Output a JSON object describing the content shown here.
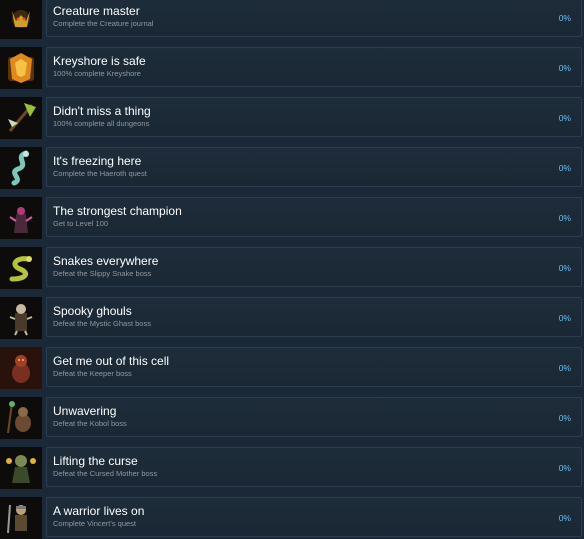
{
  "achievements": [
    {
      "title": "Creature master",
      "description": "Complete the Creature journal",
      "progress": "0%",
      "icon": "horned-creature-icon",
      "accent": "#c9a227"
    },
    {
      "title": "Kreyshore is safe",
      "description": "100% complete Kreyshore",
      "progress": "0%",
      "icon": "golden-crest-icon",
      "accent": "#e08a1e"
    },
    {
      "title": "Didn't miss a thing",
      "description": "100% complete all dungeons",
      "progress": "0%",
      "icon": "crossed-axes-icon",
      "accent": "#9bbf3a"
    },
    {
      "title": "It's freezing here",
      "description": "Complete the Haeroth quest",
      "progress": "0%",
      "icon": "ice-serpent-icon",
      "accent": "#7fc6b8"
    },
    {
      "title": "The strongest champion",
      "description": "Get to Level 100",
      "progress": "0%",
      "icon": "dark-champion-icon",
      "accent": "#b33a7a"
    },
    {
      "title": "Snakes everywhere",
      "description": "Defeat the Slippy Snake boss",
      "progress": "0%",
      "icon": "green-snake-icon",
      "accent": "#b5c23a"
    },
    {
      "title": "Spooky ghouls",
      "description": "Defeat the Mystic Ghast boss",
      "progress": "0%",
      "icon": "ghoul-icon",
      "accent": "#c8b8a0"
    },
    {
      "title": "Get me out of this cell",
      "description": "Defeat the Keeper boss",
      "progress": "0%",
      "icon": "keeper-icon",
      "accent": "#a0402a"
    },
    {
      "title": "Unwavering",
      "description": "Defeat the Kobol boss",
      "progress": "0%",
      "icon": "kobol-icon",
      "accent": "#5fb36a"
    },
    {
      "title": "Lifting the curse",
      "description": "Defeat the Cursed Mother boss",
      "progress": "0%",
      "icon": "cursed-mother-icon",
      "accent": "#e0b52a"
    },
    {
      "title": "A warrior lives on",
      "description": "Complete Vincert's quest",
      "progress": "0%",
      "icon": "warrior-icon",
      "accent": "#c0a070"
    }
  ]
}
